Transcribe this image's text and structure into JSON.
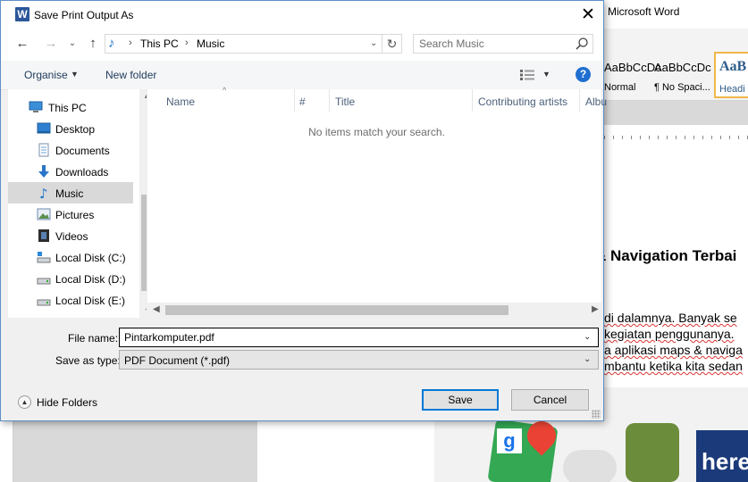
{
  "dialog": {
    "title": "Save Print Output As",
    "app_icon": "W",
    "close_glyph": "✕"
  },
  "address": {
    "crumbs": [
      "This PC",
      "Music"
    ],
    "separator": "›"
  },
  "search": {
    "placeholder": "Search Music"
  },
  "toolbar": {
    "organise_label": "Organise",
    "new_folder_label": "New folder",
    "help_glyph": "?"
  },
  "nav_pane": {
    "items": [
      {
        "label": "This PC",
        "icon": "computer-icon",
        "selected": false
      },
      {
        "label": "Desktop",
        "icon": "desktop-icon",
        "selected": false
      },
      {
        "label": "Documents",
        "icon": "documents-icon",
        "selected": false
      },
      {
        "label": "Downloads",
        "icon": "downloads-icon",
        "selected": false
      },
      {
        "label": "Music",
        "icon": "music-icon",
        "selected": true
      },
      {
        "label": "Pictures",
        "icon": "pictures-icon",
        "selected": false
      },
      {
        "label": "Videos",
        "icon": "videos-icon",
        "selected": false
      },
      {
        "label": "Local Disk (C:)",
        "icon": "system-drive-icon",
        "selected": false
      },
      {
        "label": "Local Disk (D:)",
        "icon": "drive-icon",
        "selected": false
      },
      {
        "label": "Local Disk (E:)",
        "icon": "drive-icon",
        "selected": false
      }
    ]
  },
  "file_list": {
    "columns": [
      "Name",
      "#",
      "Title",
      "Contributing artists",
      "Albu"
    ],
    "empty_message": "No items match your search."
  },
  "form": {
    "filename_label": "File name:",
    "filename_value": "Pintarkomputer.pdf",
    "saveas_label": "Save as type:",
    "saveas_value": "PDF Document (*.pdf)"
  },
  "footer": {
    "hide_folders_label": "Hide Folders",
    "save_label": "Save",
    "cancel_label": "Cancel"
  },
  "word": {
    "title": "Microsoft Word",
    "styles": [
      {
        "sample": "AaBbCcDc",
        "label": "Normal"
      },
      {
        "sample": "AaBbCcDc",
        "label": "¶ No Spaci..."
      },
      {
        "sample": "AaB",
        "label": "Headi"
      }
    ],
    "heading_fragment": "& Navigation Terbai",
    "body_lines": [
      "di dalamnya. Banyak se",
      "kegiatan penggunanya.",
      "a aplikasi maps & naviga",
      "mbantu ketika kita sedan"
    ],
    "here_logo_text": "here"
  },
  "colors": {
    "accent": "#0078d7",
    "selection": "#d9d9d9",
    "column_header": "#4c607a",
    "word_brand": "#2b579a"
  }
}
